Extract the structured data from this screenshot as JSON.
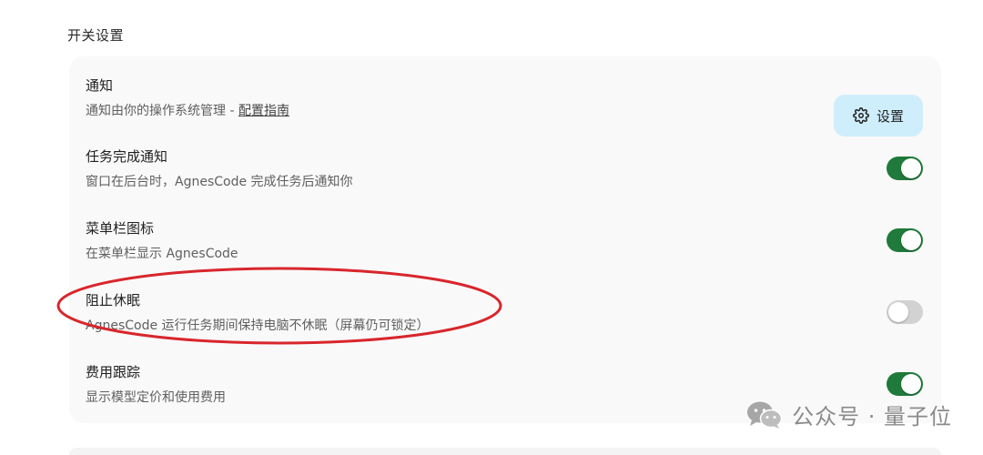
{
  "section": {
    "title": "开关设置"
  },
  "rows": [
    {
      "title": "通知",
      "desc_prefix": "通知由你的操作系统管理 - ",
      "desc_link": "配置指南",
      "button_label": "设置"
    },
    {
      "title": "任务完成通知",
      "desc": "窗口在后台时，AgnesCode 完成任务后通知你",
      "enabled": true
    },
    {
      "title": "菜单栏图标",
      "desc": "在菜单栏显示 AgnesCode",
      "enabled": true
    },
    {
      "title": "阻止休眠",
      "desc": "AgnesCode 运行任务期间保持电脑不休眠（屏幕仍可锁定）",
      "enabled": false
    },
    {
      "title": "费用跟踪",
      "desc": "显示模型定价和使用费用",
      "enabled": true
    }
  ],
  "watermark": {
    "text": "公众号 · 量子位",
    "icon": "wechat-icon"
  },
  "colors": {
    "toggle_on": "#1f7a3b",
    "toggle_off": "#d2d2d2",
    "button_bg": "#cfeefc",
    "annotation": "#d8262c"
  }
}
